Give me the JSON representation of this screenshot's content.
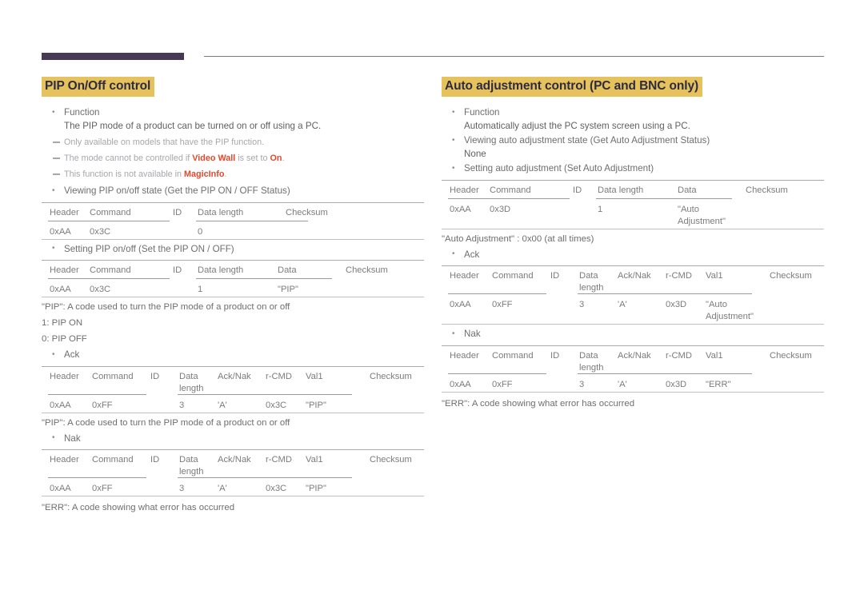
{
  "header": {
    "bar_color": "#453a51",
    "rule_color": "#7a7a7a"
  },
  "theme": {
    "title_highlight": "#e6c25c",
    "title_text": "#2f2a44",
    "emphasis": "#e8462b",
    "body_text": "#6d6e71",
    "note_text": "#a8a6ab"
  },
  "left": {
    "title": "PIP On/Off control",
    "function_label": "Function",
    "function_desc": "The PIP mode of a product can be turned on or off using a PC.",
    "notes": [
      {
        "parts": [
          {
            "t": "Only available on models that have the PIP function.",
            "hl": false
          }
        ]
      },
      {
        "parts": [
          {
            "t": "The mode cannot be controlled if ",
            "hl": false
          },
          {
            "t": "Video Wall",
            "hl": true
          },
          {
            "t": " is set to ",
            "hl": false
          },
          {
            "t": "On",
            "hl": true
          },
          {
            "t": ".",
            "hl": false
          }
        ]
      },
      {
        "parts": [
          {
            "t": "This function is not available in ",
            "hl": false
          },
          {
            "t": "MagicInfo",
            "hl": true
          },
          {
            "t": ".",
            "hl": false
          }
        ]
      }
    ],
    "get_label": "Viewing PIP on/off state (Get the PIP ON / OFF Status)",
    "get_table": {
      "headers": [
        "Header",
        "Command",
        "ID",
        "Data length",
        "Checksum"
      ],
      "values": [
        "0xAA",
        "0x3C",
        "",
        "0",
        ""
      ]
    },
    "set_label": "Setting PIP on/off (Set the PIP ON / OFF)",
    "set_table": {
      "headers": [
        "Header",
        "Command",
        "ID",
        "Data length",
        "Data",
        "Checksum"
      ],
      "values": [
        "0xAA",
        "0x3C",
        "",
        "1",
        "\"PIP\"",
        ""
      ]
    },
    "pip_code_note": "\"PIP\": A code used to turn the PIP mode of a product on or off",
    "pip_on": "1: PIP ON",
    "pip_off": "0: PIP OFF",
    "ack_label": "Ack",
    "ack_table": {
      "headers": [
        "Header",
        "Command",
        "ID",
        "Data\nlength",
        "Ack/Nak",
        "r-CMD",
        "Val1",
        "Checksum"
      ],
      "values": [
        "0xAA",
        "0xFF",
        "",
        "3",
        "'A'",
        "0x3C",
        "\"PIP\"",
        ""
      ]
    },
    "ack_note": "\"PIP\": A code used to turn the PIP mode of a product on or off",
    "nak_label": "Nak",
    "nak_table": {
      "headers": [
        "Header",
        "Command",
        "ID",
        "Data\nlength",
        "Ack/Nak",
        "r-CMD",
        "Val1",
        "Checksum"
      ],
      "values": [
        "0xAA",
        "0xFF",
        "",
        "3",
        "'A'",
        "0x3C",
        "\"PIP\"",
        ""
      ]
    },
    "err_note": "\"ERR\": A code showing what error has occurred"
  },
  "right": {
    "title": "Auto adjustment control (PC and BNC only)",
    "function_label": "Function",
    "function_desc": "Automatically adjust the PC system screen using a PC.",
    "get_label": "Viewing auto adjustment state (Get Auto Adjustment Status)",
    "get_value": "None",
    "set_label": "Setting auto adjustment (Set Auto Adjustment)",
    "set_table": {
      "headers": [
        "Header",
        "Command",
        "ID",
        "Data length",
        "Data",
        "Checksum"
      ],
      "values": [
        "0xAA",
        "0x3D",
        "",
        "1",
        "\"Auto\nAdjustment\"",
        ""
      ]
    },
    "auto_adj_note": "\"Auto Adjustment\" : 0x00 (at all times)",
    "ack_label": "Ack",
    "ack_table": {
      "headers": [
        "Header",
        "Command",
        "ID",
        "Data\nlength",
        "Ack/Nak",
        "r-CMD",
        "Val1",
        "Checksum"
      ],
      "values": [
        "0xAA",
        "0xFF",
        "",
        "3",
        "'A'",
        "0x3D",
        "\"Auto\nAdjustment\"",
        ""
      ]
    },
    "nak_label": "Nak",
    "nak_table": {
      "headers": [
        "Header",
        "Command",
        "ID",
        "Data\nlength",
        "Ack/Nak",
        "r-CMD",
        "Val1",
        "Checksum"
      ],
      "values": [
        "0xAA",
        "0xFF",
        "",
        "3",
        "'A'",
        "0x3D",
        "\"ERR\"",
        ""
      ]
    },
    "err_note": "\"ERR\": A code showing what error has occurred"
  }
}
